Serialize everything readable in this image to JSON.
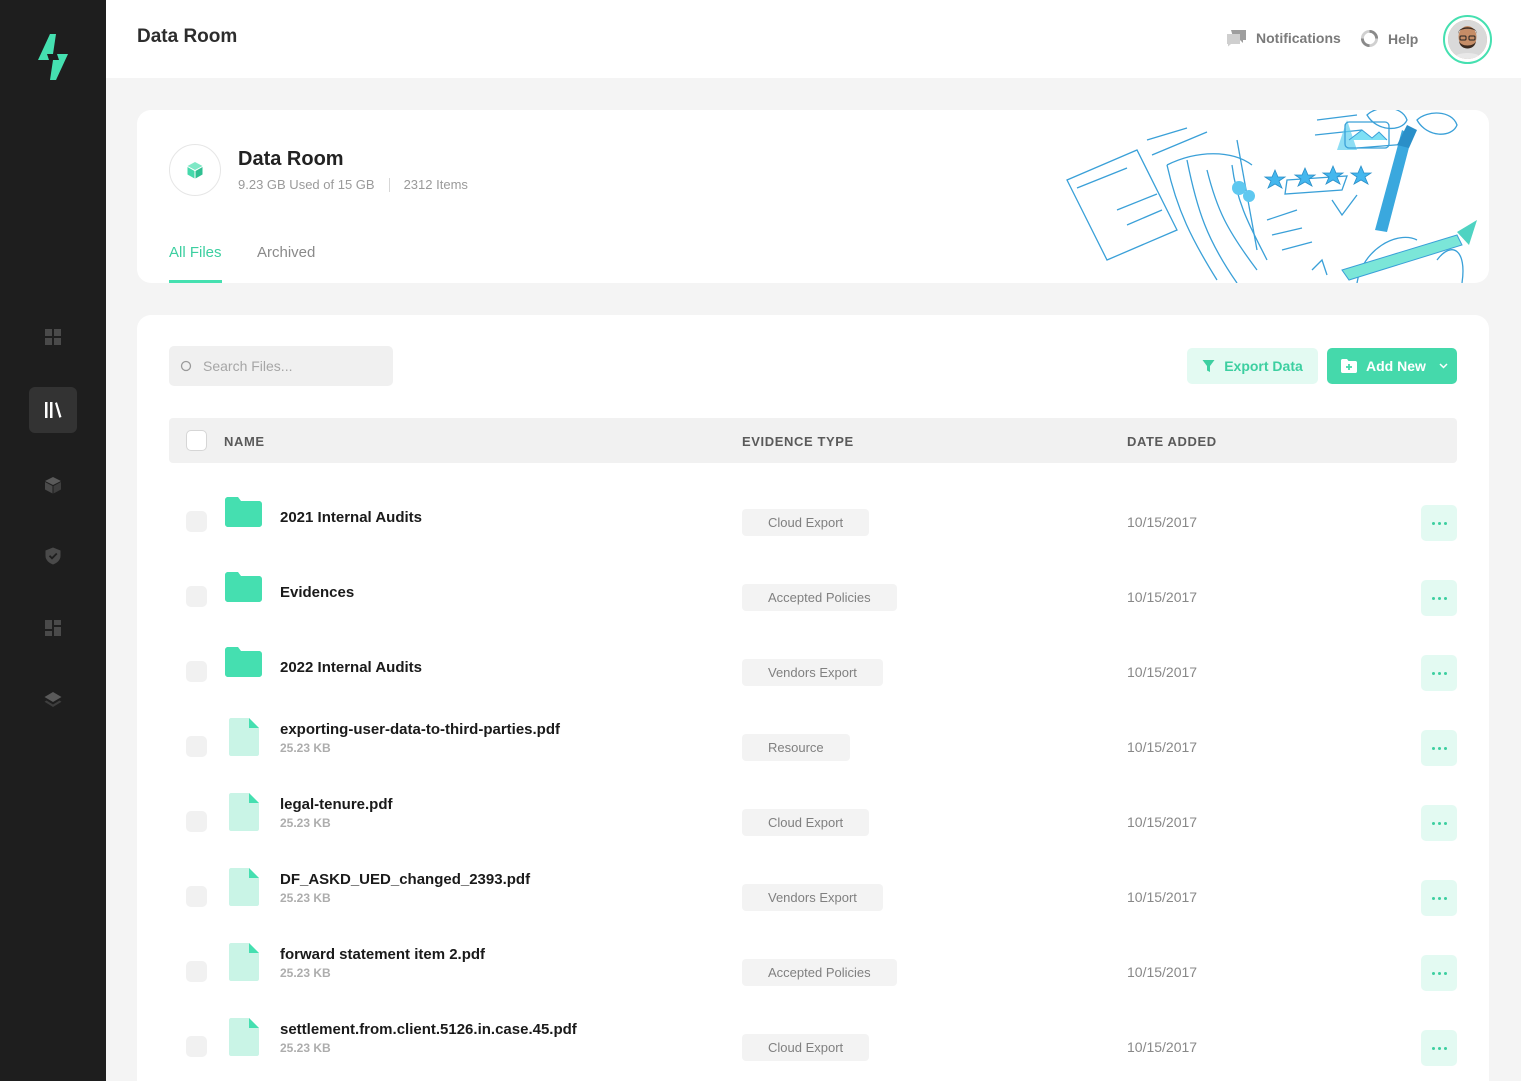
{
  "app": {
    "page_title": "Data Room",
    "accent_color": "#45D9AB",
    "sidebar_color": "#1E1E1E"
  },
  "sidebar": {
    "logo_icon": "lightning-logo-icon",
    "items": [
      {
        "icon": "dashboard-icon",
        "active": false
      },
      {
        "icon": "library-icon",
        "active": true
      },
      {
        "icon": "cube-icon",
        "active": false
      },
      {
        "icon": "shield-icon",
        "active": false
      },
      {
        "icon": "layout-icon",
        "active": false
      },
      {
        "icon": "layers-icon",
        "active": false
      }
    ]
  },
  "topbar": {
    "title": "Data Room",
    "notifications_label": "Notifications",
    "help_label": "Help"
  },
  "room": {
    "title": "Data Room",
    "storage": "9.23 GB Used of 15 GB",
    "items": "2312 Items",
    "tabs": [
      {
        "label": "All Files",
        "active": true
      },
      {
        "label": "Archived",
        "active": false
      }
    ]
  },
  "toolbar": {
    "search_placeholder": "Search Files...",
    "export_label": "Export Data",
    "add_label": "Add New"
  },
  "table": {
    "columns": [
      "NAME",
      "EVIDENCE TYPE",
      "DATE ADDED"
    ],
    "rows": [
      {
        "type": "folder",
        "name": "2021 Internal Audits",
        "size": "",
        "evidence": "Cloud Export",
        "date": "10/15/2017"
      },
      {
        "type": "folder",
        "name": "Evidences",
        "size": "",
        "evidence": "Accepted Policies",
        "date": "10/15/2017"
      },
      {
        "type": "folder",
        "name": "2022 Internal Audits",
        "size": "",
        "evidence": "Vendors Export",
        "date": "10/15/2017"
      },
      {
        "type": "file",
        "name": "exporting-user-data-to-third-parties.pdf",
        "size": "25.23 KB",
        "evidence": "Resource",
        "date": "10/15/2017"
      },
      {
        "type": "file",
        "name": "legal-tenure.pdf",
        "size": "25.23 KB",
        "evidence": "Cloud Export",
        "date": "10/15/2017"
      },
      {
        "type": "file",
        "name": "DF_ASKD_UED_changed_2393.pdf",
        "size": "25.23 KB",
        "evidence": "Vendors Export",
        "date": "10/15/2017"
      },
      {
        "type": "file",
        "name": "forward statement item 2.pdf",
        "size": "25.23 KB",
        "evidence": "Accepted Policies",
        "date": "10/15/2017"
      },
      {
        "type": "file",
        "name": "settlement.from.client.5126.in.case.45.pdf",
        "size": "25.23 KB",
        "evidence": "Cloud Export",
        "date": "10/15/2017"
      }
    ]
  }
}
